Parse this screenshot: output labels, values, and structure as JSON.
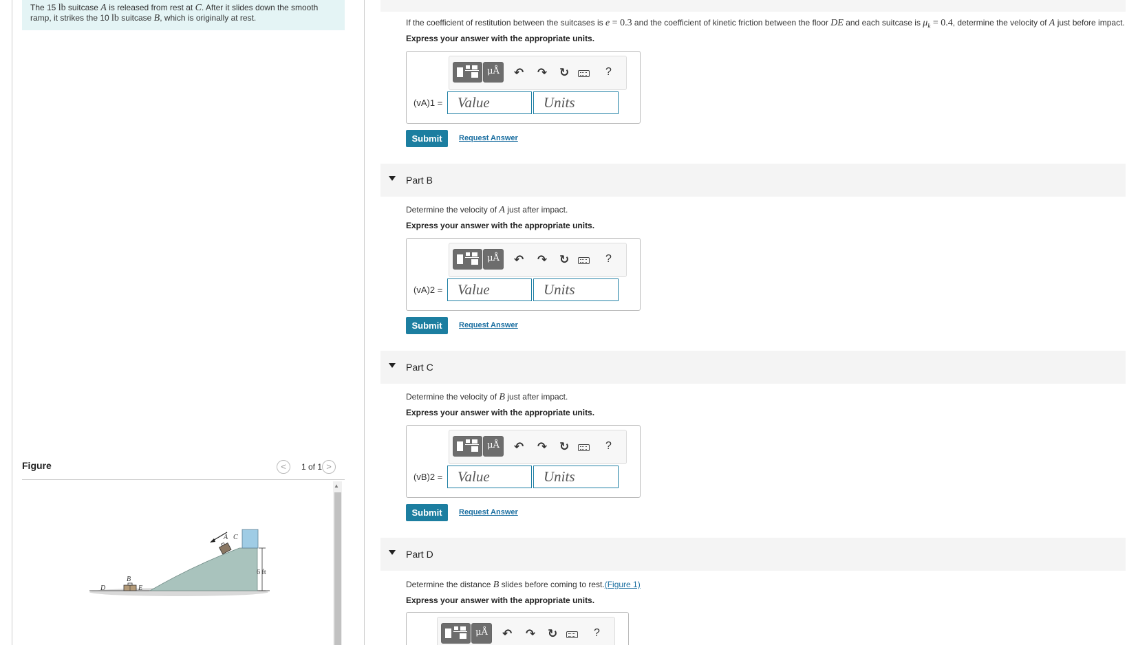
{
  "problem": {
    "text_1": "The 15 ",
    "w_a": "lb",
    "text_2": " suitcase ",
    "A": "A",
    "text_3": " is released from rest at ",
    "C": "C",
    "text_4": ". After it slides down the smooth ramp, it strikes the 10 ",
    "w_b": "lb",
    "text_5": " suitcase ",
    "B": "B",
    "text_6": ", which is originally at rest."
  },
  "figure": {
    "label": "Figure",
    "count": "1 of 1",
    "prev_icon": "<",
    "next_icon": ">",
    "labels": {
      "A": "A",
      "B": "B",
      "C": "C",
      "D": "D",
      "E": "E",
      "height": "6 ft"
    }
  },
  "part_a": {
    "q1": "If the coefficient of restitution between the suitcases is ",
    "e_sym": "e",
    "e_val": " = 0.3",
    "q2": " and the coefficient of kinetic friction between the floor ",
    "DE": "DE",
    "q3": " and each suitcase is ",
    "mu": "μ",
    "mu_sub": "k",
    "mu_val": " = 0.4",
    "q4": ", determine the velocity of ",
    "A": "A",
    "q5": " just before impact.",
    "instruction": "Express your answer with the appropriate units.",
    "var_label": "(vA)1 =",
    "value_placeholder": "Value",
    "units_placeholder": "Units",
    "submit": "Submit",
    "request": "Request Answer"
  },
  "part_b": {
    "title": "Part B",
    "q1": "Determine the velocity of ",
    "A": "A",
    "q2": " just after impact.",
    "instruction": "Express your answer with the appropriate units.",
    "var_label": "(vA)2 =",
    "value_placeholder": "Value",
    "units_placeholder": "Units",
    "submit": "Submit",
    "request": "Request Answer"
  },
  "part_c": {
    "title": "Part C",
    "q1": "Determine the velocity of ",
    "B": "B",
    "q2": " just after impact.",
    "instruction": "Express your answer with the appropriate units.",
    "var_label": "(vB)2 =",
    "value_placeholder": "Value",
    "units_placeholder": "Units",
    "submit": "Submit",
    "request": "Request Answer"
  },
  "part_d": {
    "title": "Part D",
    "q1": "Determine the distance ",
    "B": "B",
    "q2": " slides before coming to rest.",
    "link": "(Figure 1)",
    "instruction": "Express your answer with the appropriate units."
  },
  "toolbar": {
    "mu_label": "μÅ",
    "undo_icon": "↶",
    "redo_icon": "↷",
    "reset_icon": "↻",
    "help": "?"
  }
}
